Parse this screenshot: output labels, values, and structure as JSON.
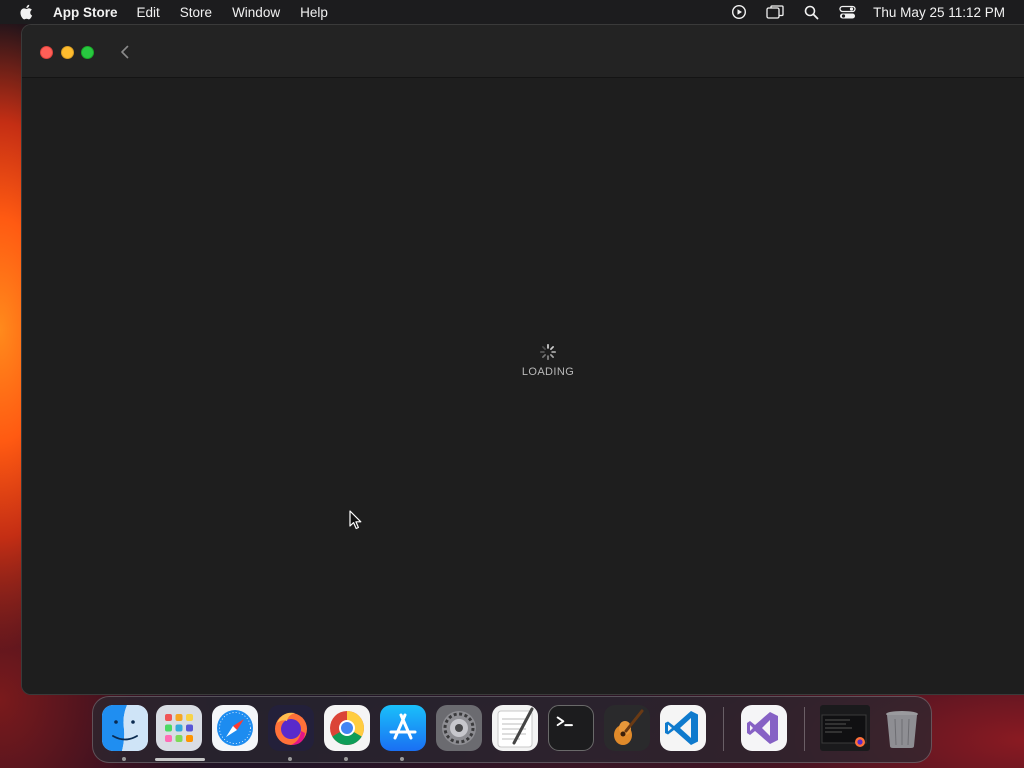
{
  "menubar": {
    "apple_icon": "apple-icon",
    "app_name": "App Store",
    "menus": [
      "Edit",
      "Store",
      "Window",
      "Help"
    ],
    "status_icons": [
      "screen-record-icon",
      "screen-mirroring-icon",
      "spotlight-search-icon",
      "control-center-icon"
    ],
    "clock": "Thu May 25  11:12 PM"
  },
  "window": {
    "traffic_lights": {
      "close": "#ff5f57",
      "minimize": "#febc2e",
      "zoom": "#28c840"
    },
    "back_icon": "chevron-left-icon",
    "loading": {
      "text": "LOADING",
      "icon": "spinner-icon"
    }
  },
  "dock": {
    "apps": [
      {
        "name": "Finder",
        "icon": "finder-icon",
        "running": true
      },
      {
        "name": "Launchpad",
        "icon": "launchpad-icon",
        "running": false
      },
      {
        "name": "Safari",
        "icon": "safari-icon",
        "running": false
      },
      {
        "name": "Firefox",
        "icon": "firefox-icon",
        "running": true
      },
      {
        "name": "Chrome",
        "icon": "chrome-icon",
        "running": true
      },
      {
        "name": "App Store",
        "icon": "app-store-icon",
        "running": true
      },
      {
        "name": "System Settings",
        "icon": "system-settings-icon",
        "running": false
      },
      {
        "name": "TextEdit",
        "icon": "textedit-icon",
        "running": false
      },
      {
        "name": "Terminal",
        "icon": "terminal-icon",
        "running": false
      },
      {
        "name": "GarageBand",
        "icon": "garageband-icon",
        "running": false
      },
      {
        "name": "Visual Studio Code",
        "icon": "vscode-icon",
        "running": false
      },
      {
        "name": "Visual Studio",
        "icon": "visual-studio-icon",
        "running": false
      }
    ],
    "minimized": {
      "icon": "minimized-window-thumbnail-icon"
    },
    "trash": {
      "icon": "trash-icon"
    }
  }
}
